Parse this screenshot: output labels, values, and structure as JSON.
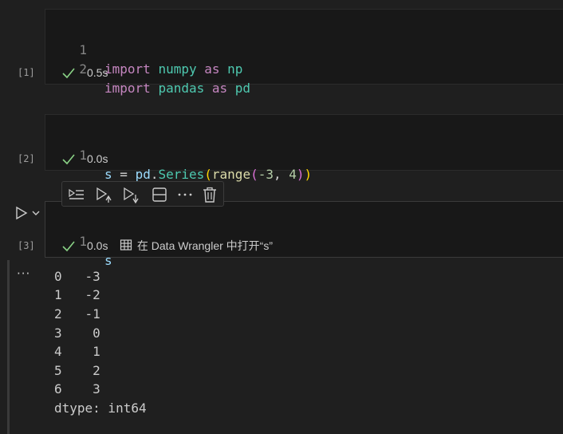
{
  "cells": [
    {
      "exec_count": "[1]",
      "lines": [
        {
          "num": "1",
          "t1": "import",
          "t2": "numpy",
          "t3": "as",
          "t4": "np"
        },
        {
          "num": "2",
          "t1": "import",
          "t2": "pandas",
          "t3": "as",
          "t4": "pd"
        }
      ],
      "duration": "0.5s"
    },
    {
      "exec_count": "[2]",
      "line": {
        "num": "1",
        "t1": "s",
        "t2": "=",
        "t3": "pd",
        "t4": ".",
        "t5": "Series",
        "t6": "(",
        "t7": "range",
        "t8": "(",
        "t9": "-3",
        "t10": ",",
        "t11": "4",
        "t12": ")",
        "t13": ")"
      },
      "duration": "0.0s"
    },
    {
      "exec_count": "[3]",
      "line": {
        "num": "1",
        "t1": "s"
      },
      "duration": "0.0s",
      "wrangler_link": "在 Data Wrangler 中打开“s”"
    }
  ],
  "output": {
    "menu": "···",
    "rows": [
      "0   -3",
      "1   -2",
      "2   -1",
      "3    0",
      "4    1",
      "5    2",
      "6    3"
    ],
    "dtype": "dtype: int64"
  },
  "toolbar": {
    "icons": [
      "execute-above-icon",
      "run-above-icon",
      "run-below-icon",
      "split-cell-icon",
      "more-icon",
      "delete-icon"
    ]
  }
}
